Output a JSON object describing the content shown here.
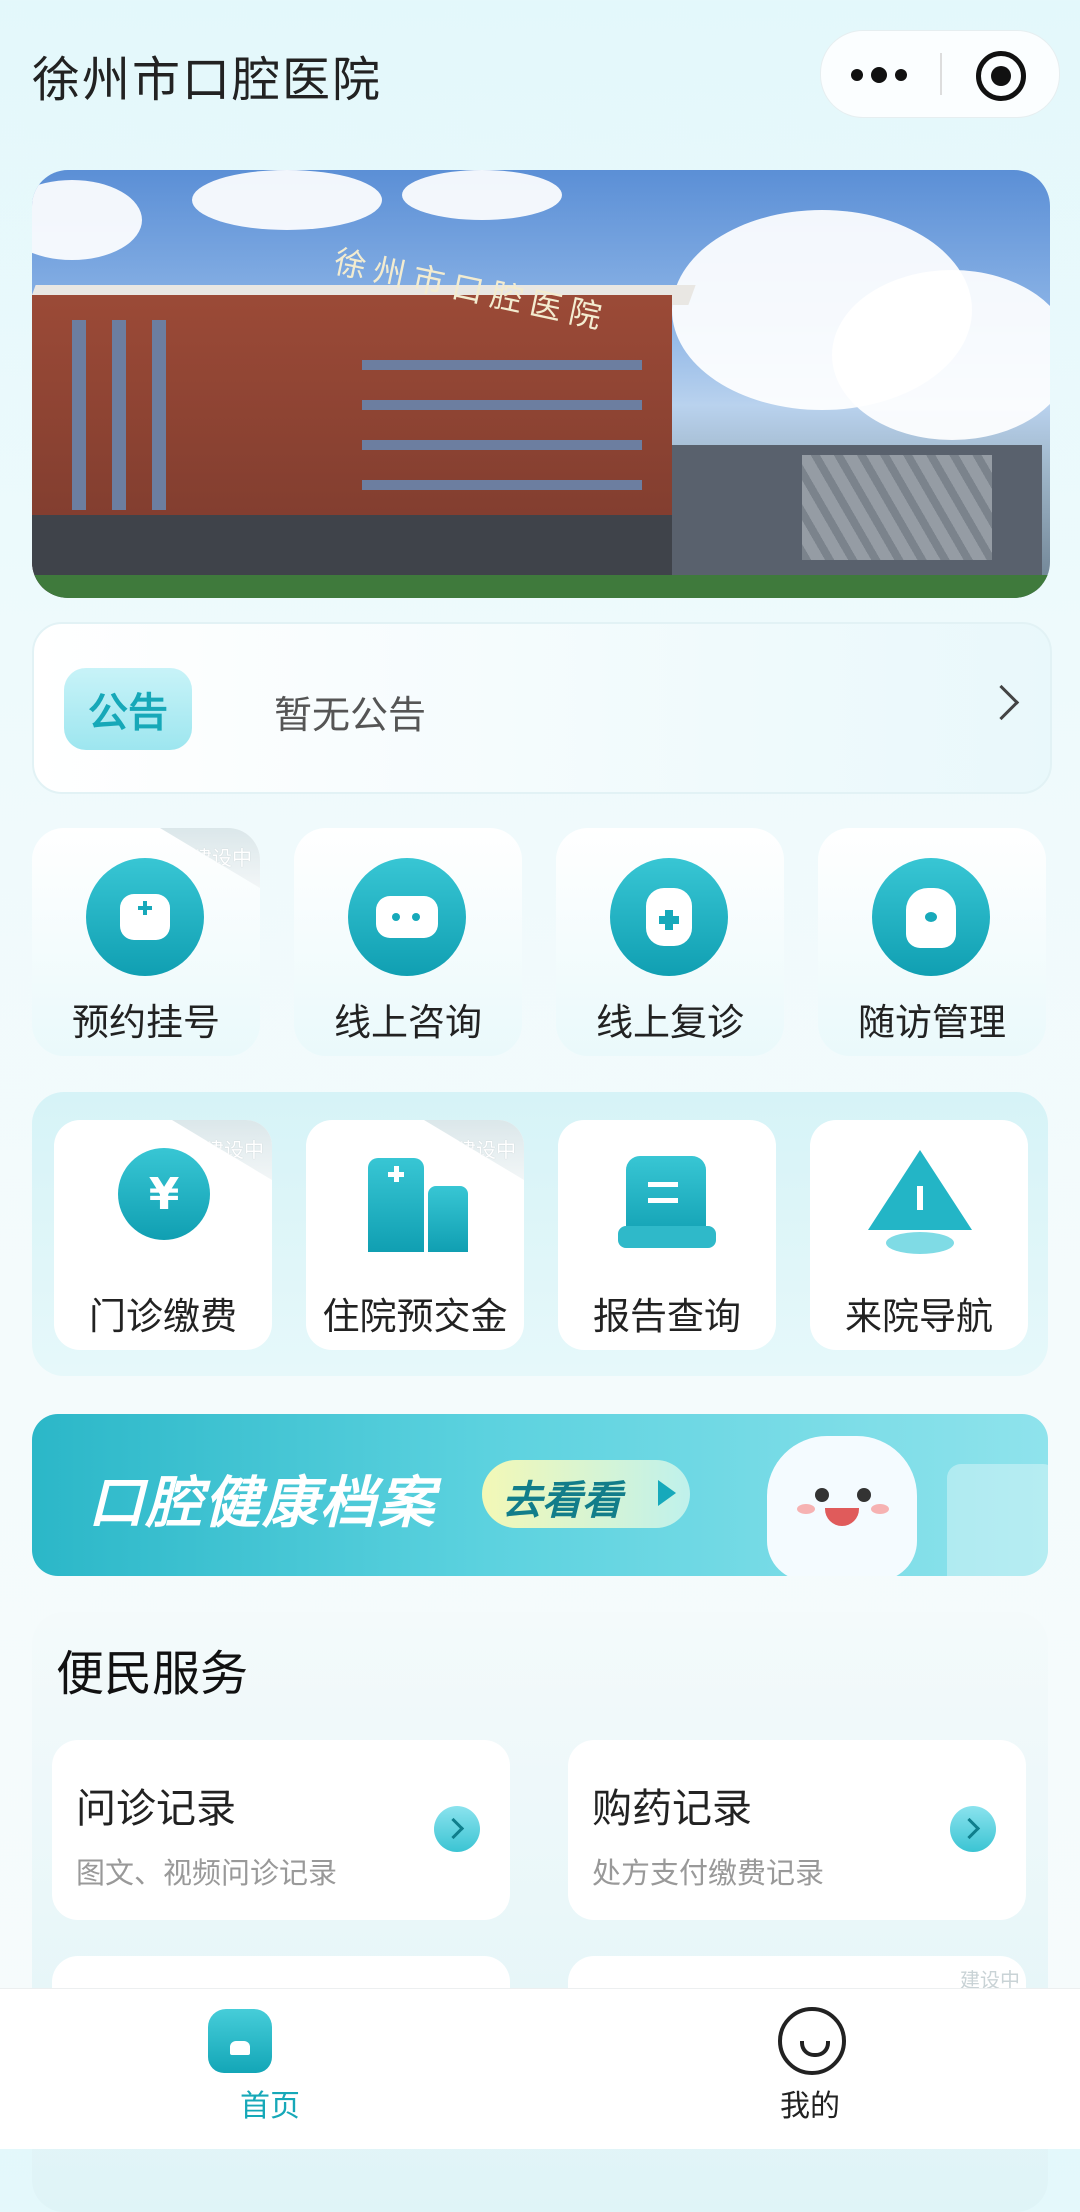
{
  "header": {
    "title": "徐州市口腔医院"
  },
  "banner": {
    "sign_text": "徐州市口腔医院"
  },
  "notice": {
    "badge": "公告",
    "text": "暂无公告"
  },
  "quick_row1": [
    {
      "label": "预约挂号",
      "icon": "calendar-plus-icon",
      "tag": "建设中"
    },
    {
      "label": "线上咨询",
      "icon": "chat-bubble-icon"
    },
    {
      "label": "线上复诊",
      "icon": "medicine-bottle-icon"
    },
    {
      "label": "随访管理",
      "icon": "tooth-icon"
    }
  ],
  "quick_row2": [
    {
      "label": "门诊缴费",
      "icon": "yuan-coin-icon",
      "tag": "建设中"
    },
    {
      "label": "住院预交金",
      "icon": "hospital-building-icon",
      "tag": "建设中"
    },
    {
      "label": "报告查询",
      "icon": "report-document-icon"
    },
    {
      "label": "来院导航",
      "icon": "location-pin-icon"
    }
  ],
  "health_banner": {
    "title": "口腔健康档案",
    "button": "去看看"
  },
  "services": {
    "title": "便民服务",
    "items": [
      {
        "title": "问诊记录",
        "subtitle": "图文、视频问诊记录"
      },
      {
        "title": "购药记录",
        "subtitle": "处方支付缴费记录"
      }
    ],
    "partial_tag": "建设中"
  },
  "tabbar": {
    "home": "首页",
    "mine": "我的"
  },
  "colors": {
    "accent": "#16a8b8",
    "accent_light": "#9de6ef",
    "text": "#222222"
  }
}
